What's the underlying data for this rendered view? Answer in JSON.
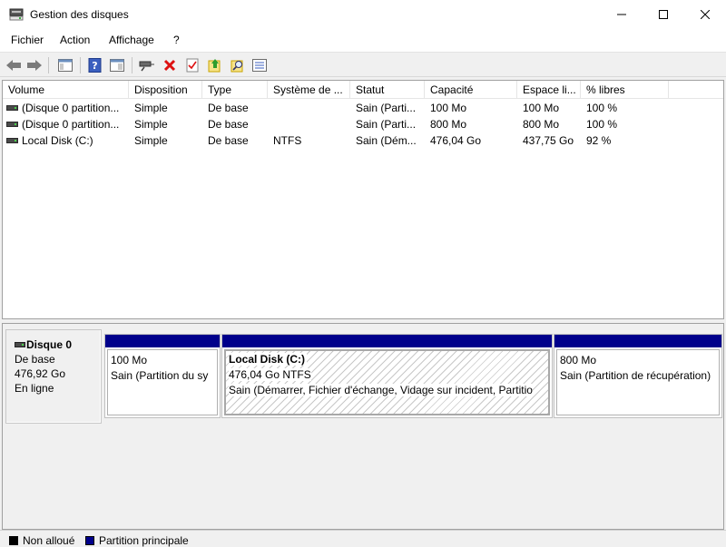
{
  "window": {
    "title": "Gestion des disques",
    "app_icon": "disk-management-icon"
  },
  "menu": [
    "Fichier",
    "Action",
    "Affichage",
    "?"
  ],
  "toolbar": {
    "buttons": [
      "back-arrow-icon",
      "forward-arrow-icon",
      "console-tree-icon",
      "help-icon",
      "properties-icon",
      "connect-drive-icon",
      "delete-icon",
      "check-icon",
      "export-icon",
      "search-icon",
      "list-icon"
    ]
  },
  "volume_list": {
    "columns": [
      "Volume",
      "Disposition",
      "Type",
      "Système de ...",
      "Statut",
      "Capacité",
      "Espace li...",
      "% libres"
    ],
    "rows": [
      {
        "volume": "(Disque 0 partition...",
        "disposition": "Simple",
        "type": "De base",
        "fs": "",
        "status": "Sain (Parti...",
        "capacity": "100 Mo",
        "free": "100 Mo",
        "pct": "100 %"
      },
      {
        "volume": "(Disque 0 partition...",
        "disposition": "Simple",
        "type": "De base",
        "fs": "",
        "status": "Sain (Parti...",
        "capacity": "800 Mo",
        "free": "800 Mo",
        "pct": "100 %"
      },
      {
        "volume": "Local Disk (C:)",
        "disposition": "Simple",
        "type": "De base",
        "fs": "NTFS",
        "status": "Sain (Dém...",
        "capacity": "476,04 Go",
        "free": "437,75 Go",
        "pct": "92 %"
      }
    ]
  },
  "disk": {
    "name": "Disque 0",
    "type": "De base",
    "size": "476,92 Go",
    "state": "En ligne",
    "partitions": [
      {
        "size": "100 Mo",
        "status": "Sain (Partition du sy"
      },
      {
        "name": "Local Disk  (C:)",
        "size": "476,04 Go NTFS",
        "status": "Sain (Démarrer, Fichier d'échange, Vidage sur incident, Partitio"
      },
      {
        "size": "800 Mo",
        "status": "Sain (Partition de récupération)"
      }
    ]
  },
  "legend": [
    {
      "label": "Non alloué",
      "color": "#000000"
    },
    {
      "label": "Partition principale",
      "color": "#00008b"
    }
  ]
}
